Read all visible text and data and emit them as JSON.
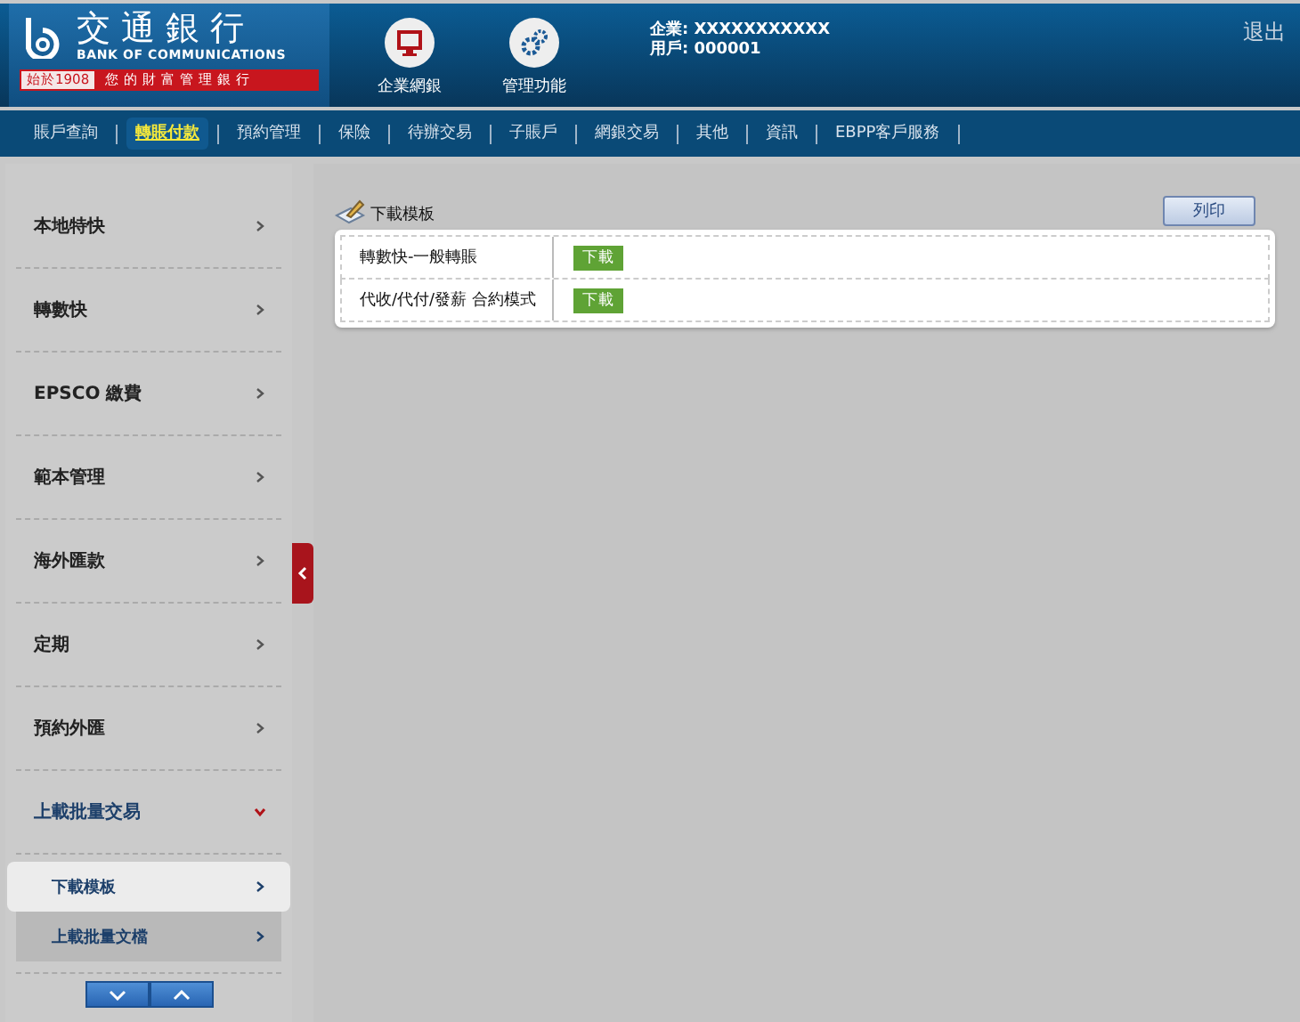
{
  "header": {
    "logo": {
      "name_zh": "交通銀行",
      "name_en": "BANK OF COMMUNICATIONS",
      "since": "始於1908",
      "slogan": "您的財富管理銀行"
    },
    "modules": [
      {
        "label": "企業網銀",
        "kind": "monitor"
      },
      {
        "label": "管理功能",
        "kind": "gears"
      }
    ],
    "company": "企業: XXXXXXXXXXX",
    "user": "用戶: 000001",
    "logout": "退出"
  },
  "nav": [
    {
      "label": "賬戶查詢",
      "selected": false
    },
    {
      "label": "轉賬付款",
      "selected": true
    },
    {
      "label": "預約管理",
      "selected": false
    },
    {
      "label": "保險",
      "selected": false
    },
    {
      "label": "待辦交易",
      "selected": false
    },
    {
      "label": "子賬戶",
      "selected": false
    },
    {
      "label": "網銀交易",
      "selected": false
    },
    {
      "label": "其他",
      "selected": false
    },
    {
      "label": "資訊",
      "selected": false
    },
    {
      "label": "EBPP客戶服務",
      "selected": false
    }
  ],
  "sidebar": {
    "items": [
      {
        "label": "本地特快",
        "expanded": false
      },
      {
        "label": "轉數快",
        "expanded": false
      },
      {
        "label": "EPSCO 繳費",
        "expanded": false
      },
      {
        "label": "範本管理",
        "expanded": false
      },
      {
        "label": "海外匯款",
        "expanded": false
      },
      {
        "label": "定期",
        "expanded": false
      },
      {
        "label": "預約外匯",
        "expanded": false
      },
      {
        "label": "上載批量交易",
        "expanded": true,
        "children": [
          {
            "label": "下載模板",
            "selected": true
          },
          {
            "label": "上載批量文檔",
            "selected": false
          }
        ]
      }
    ]
  },
  "content": {
    "title": "下載模板",
    "print_button": "列印",
    "rows": [
      {
        "name": "轉數快-一般轉賬",
        "action": "下載"
      },
      {
        "name": "代收/代付/發薪 合約模式",
        "action": "下載"
      }
    ]
  }
}
